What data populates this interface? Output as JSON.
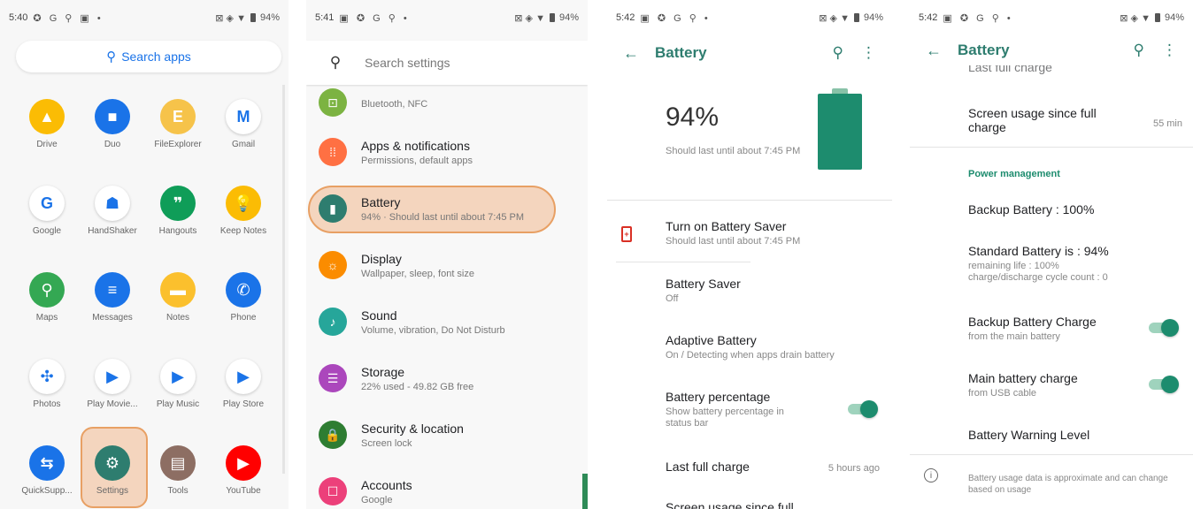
{
  "colors": {
    "accent": "#1d8c6e",
    "highlight": "#f0aa78",
    "battery_saver": "#d93025"
  },
  "panel1": {
    "status": {
      "time": "5:40",
      "icons": "✪ G ⚲ ▣ •",
      "right": "⊠ ◈ ▼",
      "battery": "94%"
    },
    "search_label": "Search apps",
    "apps": [
      {
        "label": "Drive",
        "icon": "drive-icon",
        "glyph": "▲",
        "color": "#fbbc04"
      },
      {
        "label": "Duo",
        "icon": "duo-icon",
        "glyph": "■",
        "color": "#1a73e8"
      },
      {
        "label": "FileExplorer",
        "icon": "file-explorer-icon",
        "glyph": "E",
        "color": "#f6c34a"
      },
      {
        "label": "Gmail",
        "icon": "gmail-icon",
        "glyph": "M",
        "color": "#ffffff"
      },
      {
        "label": "Google",
        "icon": "google-icon",
        "glyph": "G",
        "color": "#ffffff"
      },
      {
        "label": "HandShaker",
        "icon": "handshaker-icon",
        "glyph": "☗",
        "color": "#ffffff"
      },
      {
        "label": "Hangouts",
        "icon": "hangouts-icon",
        "glyph": "❞",
        "color": "#0f9d58"
      },
      {
        "label": "Keep Notes",
        "icon": "keep-notes-icon",
        "glyph": "💡",
        "color": "#fbbc04"
      },
      {
        "label": "Maps",
        "icon": "maps-icon",
        "glyph": "⚲",
        "color": "#34a853"
      },
      {
        "label": "Messages",
        "icon": "messages-icon",
        "glyph": "≡",
        "color": "#1a73e8"
      },
      {
        "label": "Notes",
        "icon": "notes-icon",
        "glyph": "▬",
        "color": "#fbc02d"
      },
      {
        "label": "Phone",
        "icon": "phone-icon",
        "glyph": "✆",
        "color": "#1a73e8"
      },
      {
        "label": "Photos",
        "icon": "photos-icon",
        "glyph": "✣",
        "color": "#ffffff"
      },
      {
        "label": "Play Movie...",
        "icon": "play-movies-icon",
        "glyph": "▶",
        "color": "#ffffff"
      },
      {
        "label": "Play Music",
        "icon": "play-music-icon",
        "glyph": "▶",
        "color": "#ffffff"
      },
      {
        "label": "Play Store",
        "icon": "play-store-icon",
        "glyph": "▶",
        "color": "#ffffff"
      },
      {
        "label": "QuickSupp...",
        "icon": "quicksupport-icon",
        "glyph": "⇆",
        "color": "#1a73e8"
      },
      {
        "label": "Settings",
        "icon": "settings-icon",
        "glyph": "⚙",
        "color": "#2e7d6f"
      },
      {
        "label": "Tools",
        "icon": "tools-icon",
        "glyph": "▤",
        "color": "#8d6e63"
      },
      {
        "label": "YouTube",
        "icon": "youtube-icon",
        "glyph": "▶",
        "color": "#ff0000"
      }
    ]
  },
  "panel2": {
    "status": {
      "time": "5:41",
      "icons": "▣ ✪ G ⚲ •",
      "right": "⊠ ◈ ▼",
      "battery": "94%"
    },
    "search_placeholder": "Search settings",
    "rows": [
      {
        "title": "",
        "subtitle": "Bluetooth, NFC",
        "icon": "connected-devices-icon",
        "glyph": "⊡",
        "color": "#7cb342"
      },
      {
        "title": "Apps & notifications",
        "subtitle": "Permissions, default apps",
        "icon": "apps-icon",
        "glyph": "⁞⁞",
        "color": "#ff7043"
      },
      {
        "title": "Battery",
        "subtitle": "94% · Should last until about 7:45 PM",
        "icon": "battery-icon",
        "glyph": "▮",
        "color": "#2e7d6f"
      },
      {
        "title": "Display",
        "subtitle": "Wallpaper, sleep, font size",
        "icon": "display-icon",
        "glyph": "☼",
        "color": "#fb8c00"
      },
      {
        "title": "Sound",
        "subtitle": "Volume, vibration, Do Not Disturb",
        "icon": "sound-icon",
        "glyph": "♪",
        "color": "#26a69a"
      },
      {
        "title": "Storage",
        "subtitle": "22% used - 49.82 GB free",
        "icon": "storage-icon",
        "glyph": "☰",
        "color": "#ab47bc"
      },
      {
        "title": "Security & location",
        "subtitle": "Screen lock",
        "icon": "security-icon",
        "glyph": "🔒",
        "color": "#2e7d32"
      },
      {
        "title": "Accounts",
        "subtitle": "Google",
        "icon": "accounts-icon",
        "glyph": "☐",
        "color": "#ec407a"
      }
    ]
  },
  "panel3": {
    "status": {
      "time": "5:42",
      "icons": "▣ ✪ G ⚲ •",
      "right": "⊠ ◈ ▼",
      "battery": "94%"
    },
    "title": "Battery",
    "percent": "94%",
    "percent_sub": "Should last until about 7:45 PM",
    "rows": [
      {
        "title": "Turn on Battery Saver",
        "subtitle": "Should last until about 7:45 PM"
      },
      {
        "title": "Battery Saver",
        "subtitle": "Off"
      },
      {
        "title": "Adaptive Battery",
        "subtitle": "On / Detecting when apps drain battery"
      },
      {
        "title": "Battery percentage",
        "subtitle": "Show battery percentage in status bar"
      },
      {
        "title": "Last full charge",
        "value": "5 hours ago"
      },
      {
        "title": "Screen usage since full"
      }
    ]
  },
  "panel4": {
    "status": {
      "time": "5:42",
      "icons": "▣ ✪ G ⚲ •",
      "right": "⊠ ◈ ▼",
      "battery": "94%"
    },
    "title": "Battery",
    "cut_top": "Last full charge",
    "screen_usage_title": "Screen usage since full charge",
    "screen_usage_value": "55 min",
    "section": "Power management",
    "rows": [
      {
        "title": "Backup Battery : 100%"
      },
      {
        "title": "Standard Battery is : 94%",
        "sub1": "remaining life : 100%",
        "sub2": "charge/discharge cycle count : 0"
      },
      {
        "title": "Backup Battery Charge",
        "subtitle": "from the main battery"
      },
      {
        "title": "Main battery charge",
        "subtitle": "from USB cable"
      },
      {
        "title": "Battery Warning Level"
      }
    ],
    "footer": "Battery usage data is approximate and can change based on usage"
  }
}
